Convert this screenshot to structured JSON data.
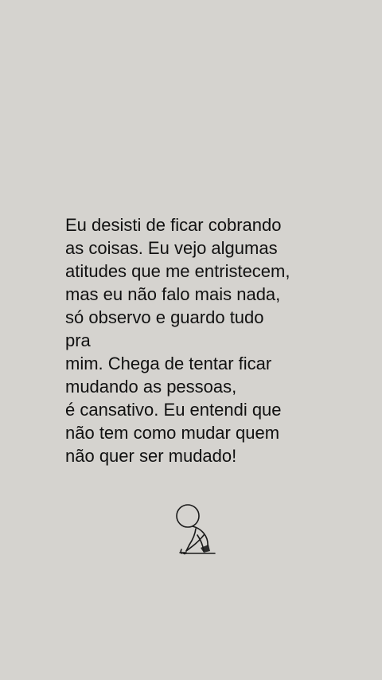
{
  "quote": {
    "lines": [
      "Eu desisti de ficar cobrando",
      "as coisas. Eu vejo algumas",
      "atitudes que me entristecem,",
      "mas eu não falo mais nada,",
      "só observo e guardo tudo",
      "pra",
      "mim. Chega de tentar ficar",
      "mudando as pessoas,",
      "é cansativo. Eu entendi que",
      "não tem como mudar quem",
      "não quer ser mudado!"
    ]
  },
  "illustration": {
    "icon": "sitting-figure-icon"
  }
}
